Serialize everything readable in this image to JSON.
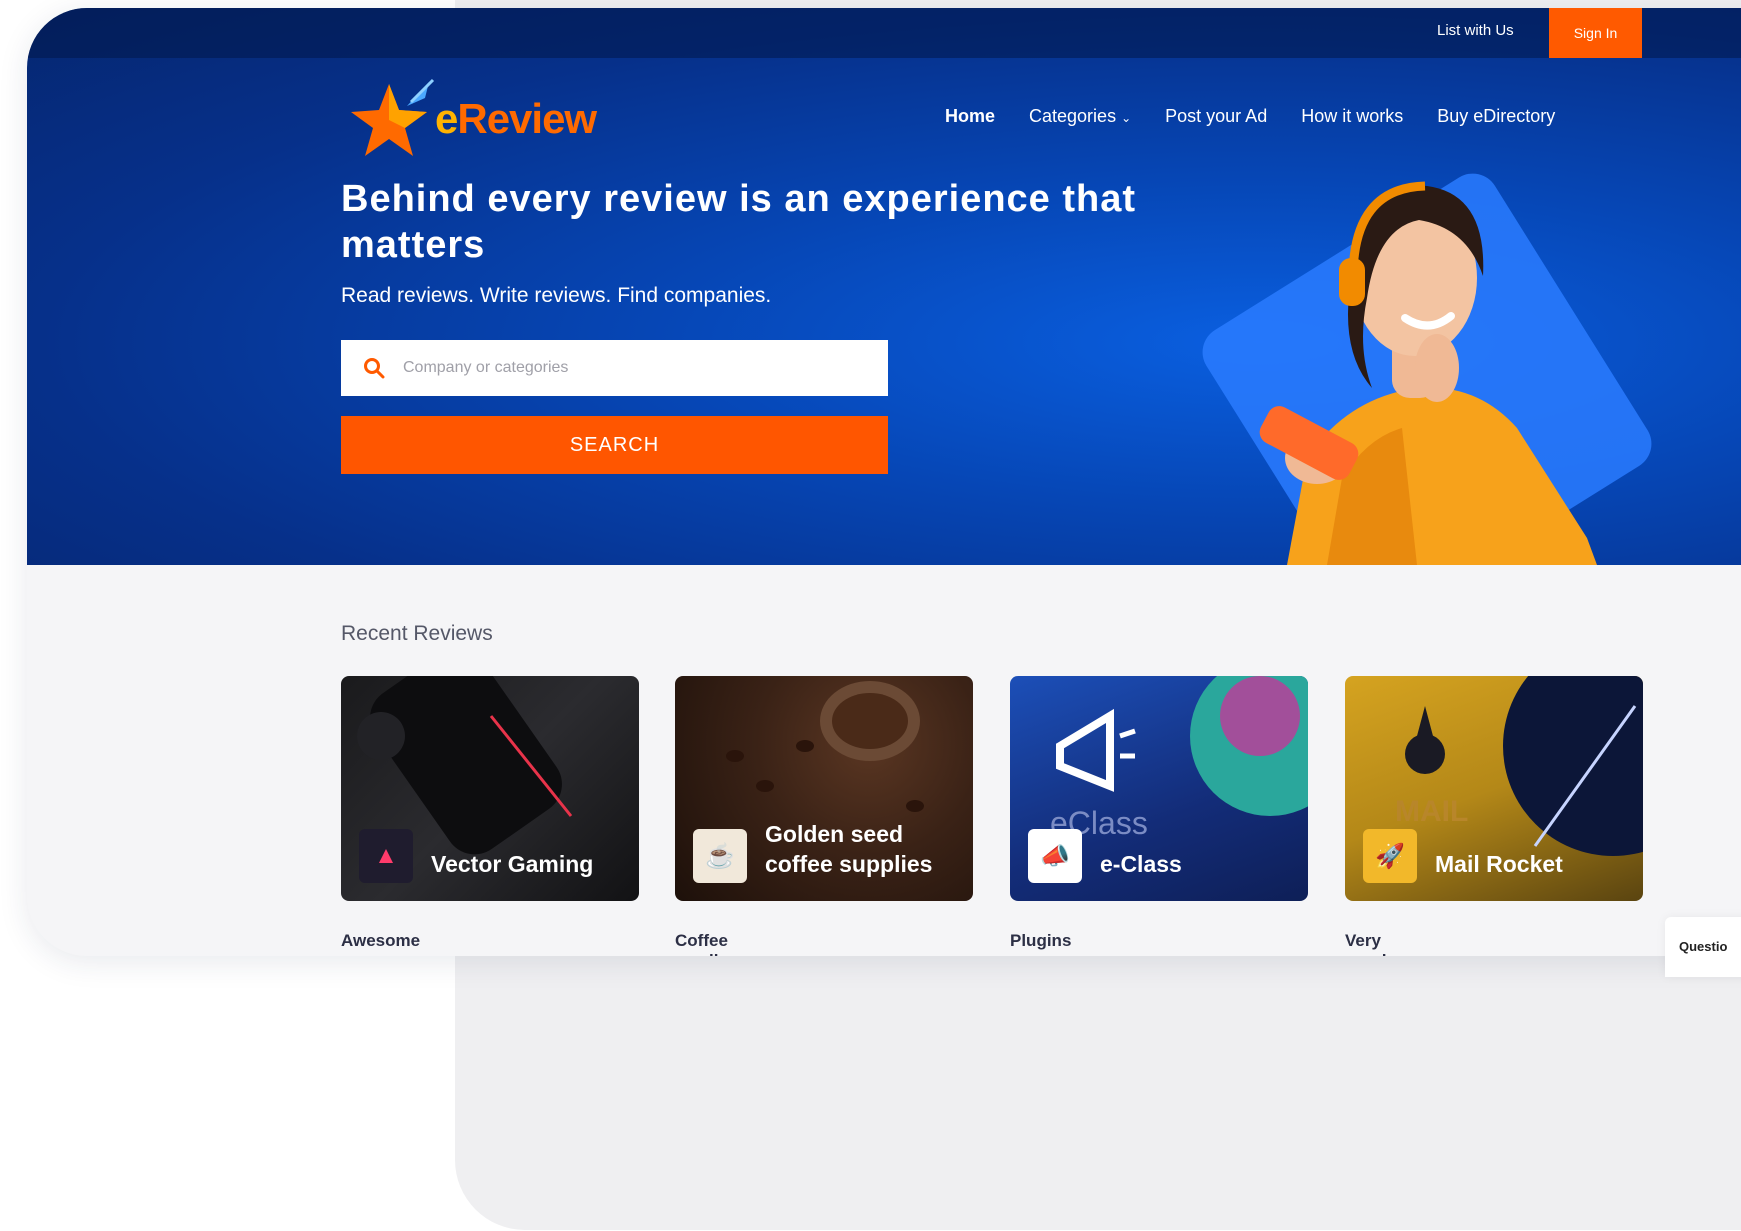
{
  "topbar": {
    "list_link": "List with Us",
    "signin": "Sign In"
  },
  "logo": {
    "prefix": "e",
    "name": "Review"
  },
  "nav": {
    "home": "Home",
    "categories": "Categories",
    "post_ad": "Post your Ad",
    "how_it_works": "How it works",
    "buy": "Buy eDirectory"
  },
  "hero": {
    "title": "Behind every review is an experience that matters",
    "subtitle": "Read reviews. Write reviews. Find companies.",
    "search_placeholder": "Company or categories",
    "search_button": "SEARCH"
  },
  "recent": {
    "title": "Recent Reviews",
    "cards": [
      {
        "name": "Vector Gaming",
        "caption": "Awesome"
      },
      {
        "name": "Golden seed coffee supplies",
        "caption": "Coffee smell"
      },
      {
        "name": "e-Class",
        "caption": "Plugins",
        "watermark": "eClass"
      },
      {
        "name": "Mail Rocket",
        "caption": "Very good",
        "watermark": "MAIL"
      }
    ]
  },
  "widget": {
    "label": "Questio"
  },
  "colors": {
    "brand_orange": "#ff5a00",
    "hero_blue": "#0646b5"
  }
}
